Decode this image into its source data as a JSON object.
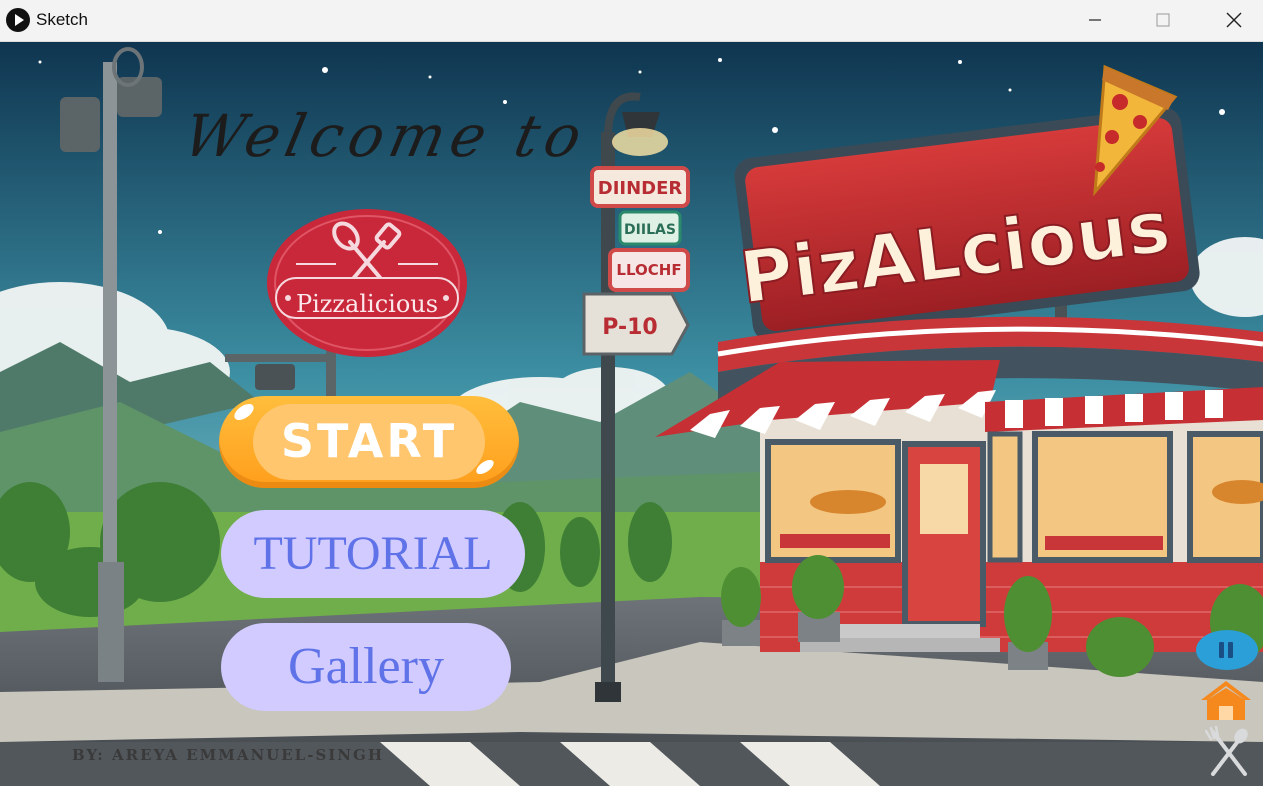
{
  "window": {
    "title": "Sketch",
    "controls": [
      "minimize",
      "maximize",
      "close"
    ]
  },
  "scene": {
    "welcome_text": "Welcome to",
    "logo_text": "Pizzalicious",
    "restaurant_sign": "PizALcious",
    "street_signs": [
      "DIINDER",
      "DIILAS",
      "LLOCHF",
      "P-10"
    ]
  },
  "menu": {
    "start_label": "START",
    "tutorial_label": "TUTORIAL",
    "gallery_label": "Gallery"
  },
  "credit": "BY: AREYA EMMANUEL-SINGH",
  "corner_controls": {
    "pause_icon": "pause-icon",
    "home_icon": "home-icon",
    "utensils_icon": "utensils-icon"
  },
  "colors": {
    "start_button": "#ffab2e",
    "menu_pill": "#d1cbff",
    "menu_text": "#5f72e8",
    "brand_red": "#c8283a"
  }
}
